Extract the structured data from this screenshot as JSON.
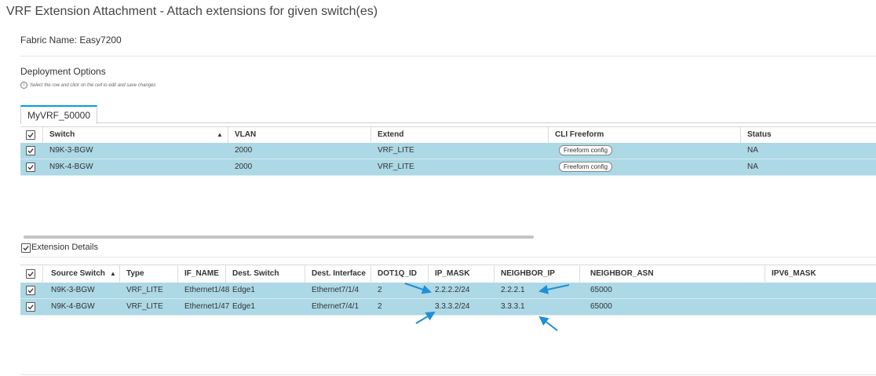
{
  "page": {
    "title": "VRF Extension Attachment - Attach extensions for given switch(es)",
    "fabric_name": "Fabric Name: Easy7200",
    "deployment_options": "Deployment Options",
    "hint": "Select the row and click on the cell to edit and save changes"
  },
  "vrf_tab": {
    "label": "MyVRF_50000"
  },
  "top_table": {
    "columns": [
      "Switch",
      "VLAN",
      "Extend",
      "CLI Freeform",
      "Status"
    ],
    "sort_icon": "▲",
    "rows": [
      {
        "switch": "N9K-3-BGW",
        "vlan": "2000",
        "extend": "VRF_LITE",
        "cli": "Freeform config",
        "status": "NA"
      },
      {
        "switch": "N9K-4-BGW",
        "vlan": "2000",
        "extend": "VRF_LITE",
        "cli": "Freeform config",
        "status": "NA"
      }
    ]
  },
  "extension_details": {
    "label": "Extension Details",
    "columns": [
      "Source Switch",
      "Type",
      "IF_NAME",
      "Dest. Switch",
      "Dest. Interface",
      "DOT1Q_ID",
      "IP_MASK",
      "NEIGHBOR_IP",
      "NEIGHBOR_ASN",
      "IPV6_MASK"
    ],
    "sort_icon": "▲",
    "rows": [
      {
        "source": "N9K-3-BGW",
        "type": "VRF_LITE",
        "if_name": "Ethernet1/48",
        "dest_switch": "Edge1",
        "dest_if": "Ethernet7/1/4",
        "dot1q": "2",
        "ip_mask": "2.2.2.2/24",
        "neighbor_ip": "2.2.2.1",
        "neighbor_asn": "65000",
        "ipv6_mask": ""
      },
      {
        "source": "N9K-4-BGW",
        "type": "VRF_LITE",
        "if_name": "Ethernet1/47",
        "dest_switch": "Edge1",
        "dest_if": "Ethernet7/4/1",
        "dot1q": "2",
        "ip_mask": "3.3.3.2/24",
        "neighbor_ip": "3.3.3.1",
        "neighbor_asn": "65000",
        "ipv6_mask": ""
      }
    ]
  },
  "colors": {
    "selected_row": "#add8e6",
    "tab_accent": "#049fd9",
    "annotation_arrow": "#1e90d6"
  }
}
